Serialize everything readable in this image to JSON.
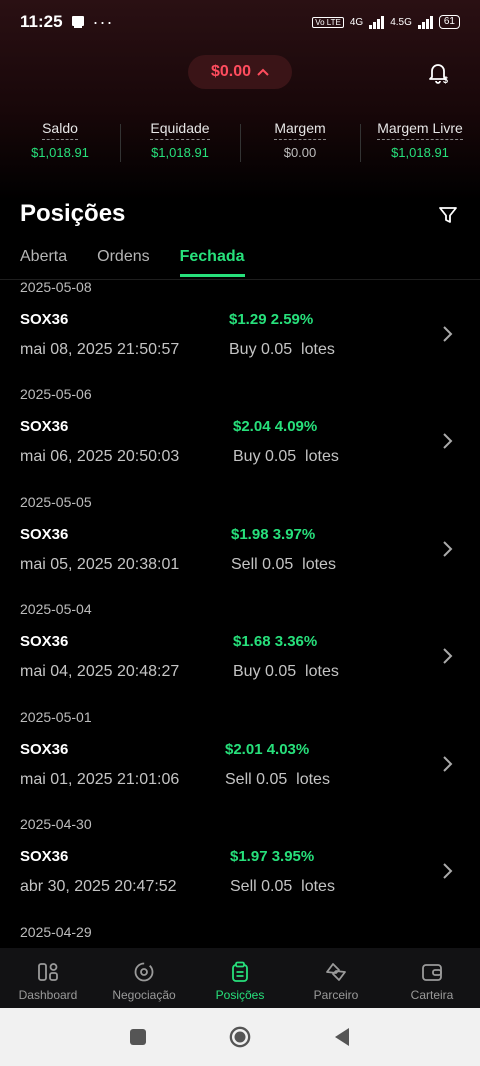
{
  "status_bar": {
    "time": "11:25",
    "dots": "···",
    "network1": "4G",
    "network2": "4.5G",
    "battery": "61"
  },
  "header": {
    "pnl": "$0.00"
  },
  "account": [
    {
      "label": "Saldo",
      "value": "$1,018.91"
    },
    {
      "label": "Equidade",
      "value": "$1,018.91"
    },
    {
      "label": "Margem",
      "value": "$0.00"
    },
    {
      "label": "Margem Livre",
      "value": "$1,018.91"
    }
  ],
  "page_title": "Posições",
  "tabs": [
    {
      "label": "Aberta"
    },
    {
      "label": "Ordens"
    },
    {
      "label": "Fechada"
    }
  ],
  "groups": [
    {
      "date": "2025-05-08",
      "symbol": "SOX36",
      "profit": "$1.29 2.59%",
      "timestamp": "mai 08, 2025 21:50:57",
      "side": "Buy 0.05  lotes"
    },
    {
      "date": "2025-05-06",
      "symbol": "SOX36",
      "profit": "$2.04 4.09%",
      "timestamp": "mai 06, 2025 20:50:03",
      "side": "Buy 0.05  lotes"
    },
    {
      "date": "2025-05-05",
      "symbol": "SOX36",
      "profit": "$1.98 3.97%",
      "timestamp": "mai 05, 2025 20:38:01",
      "side": "Sell 0.05  lotes"
    },
    {
      "date": "2025-05-04",
      "symbol": "SOX36",
      "profit": "$1.68 3.36%",
      "timestamp": "mai 04, 2025 20:48:27",
      "side": "Buy 0.05  lotes"
    },
    {
      "date": "2025-05-01",
      "symbol": "SOX36",
      "profit": "$2.01 4.03%",
      "timestamp": "mai 01, 2025 21:01:06",
      "side": "Sell 0.05  lotes"
    },
    {
      "date": "2025-04-30",
      "symbol": "SOX36",
      "profit": "$1.97 3.95%",
      "timestamp": "abr 30, 2025 20:47:52",
      "side": "Sell 0.05  lotes"
    },
    {
      "date": "2025-04-29"
    }
  ],
  "bottom_nav": [
    {
      "label": "Dashboard"
    },
    {
      "label": "Negociação"
    },
    {
      "label": "Posições"
    },
    {
      "label": "Parceiro"
    },
    {
      "label": "Carteira"
    }
  ],
  "colors": {
    "accent": "#27e07b",
    "loss": "#ff4d5e"
  }
}
